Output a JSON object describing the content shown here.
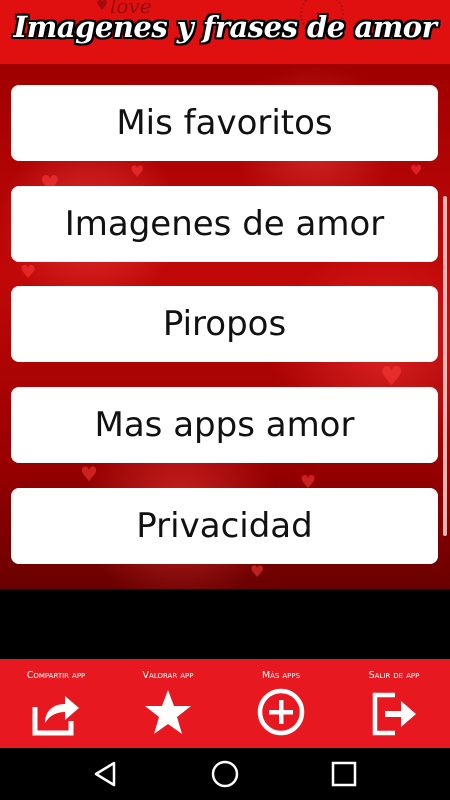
{
  "header": {
    "title": "Imagenes y frases de amor",
    "decoration_text": "love"
  },
  "menu": {
    "items": [
      {
        "label": "Mis favoritos"
      },
      {
        "label": "Imagenes de amor"
      },
      {
        "label": "Piropos"
      },
      {
        "label": "Mas apps amor"
      },
      {
        "label": "Privacidad"
      }
    ]
  },
  "toolbar": {
    "share_label": "Compartir app",
    "rate_label": "Valorar app",
    "more_label": "Más apps",
    "exit_label": "Salir de app"
  },
  "icons": {
    "share": "share-icon",
    "star": "star-icon",
    "plus": "plus-circle-icon",
    "exit": "exit-icon"
  },
  "colors": {
    "header": "#e01010",
    "toolbar": "#e81820",
    "button": "#ffffff"
  }
}
